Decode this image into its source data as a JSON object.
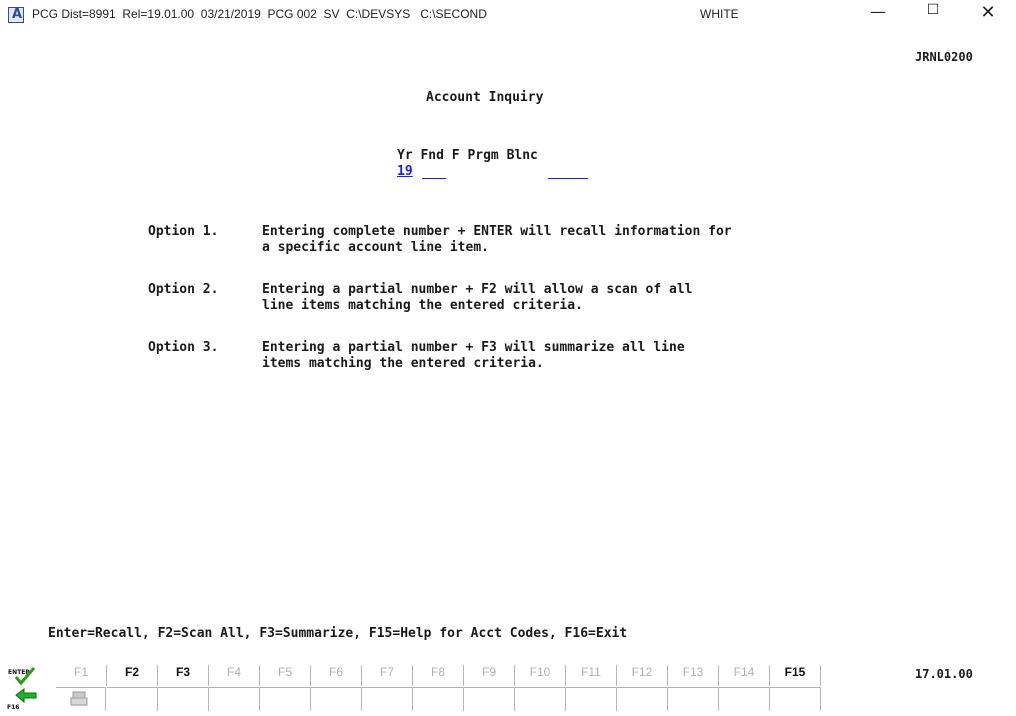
{
  "titlebar": {
    "icon_letter": "A",
    "text": "PCG Dist=8991  Rel=19.01.00  03/21/2019  PCG 002  SV  C:\\DEVSYS   C:\\SECOND",
    "user": "WHITE",
    "minimize": "—",
    "maximize": "☐",
    "close": "✕"
  },
  "screen_id": "JRNL0200",
  "page_title": "Account Inquiry",
  "account_header": "Yr Fnd F Prgm Blnc",
  "year_value": "19",
  "options": [
    {
      "label": "Option 1.",
      "line1": "Entering complete number + ENTER will recall information for",
      "line2": "a specific account line item."
    },
    {
      "label": "Option 2.",
      "line1": "Entering a partial number + F2 will allow a scan of all",
      "line2": "line items matching the entered criteria."
    },
    {
      "label": "Option 3.",
      "line1": "Entering a partial number + F3 will summarize all line",
      "line2": "items matching the entered criteria."
    }
  ],
  "help_line": "Enter=Recall, F2=Scan All, F3=Summarize, F15=Help for Acct Codes, F16=Exit",
  "version": "17.01.00",
  "fkeys": [
    {
      "label": "F1",
      "enabled": false
    },
    {
      "label": "F2",
      "enabled": true
    },
    {
      "label": "F3",
      "enabled": true
    },
    {
      "label": "F4",
      "enabled": false
    },
    {
      "label": "F5",
      "enabled": false
    },
    {
      "label": "F6",
      "enabled": false
    },
    {
      "label": "F7",
      "enabled": false
    },
    {
      "label": "F8",
      "enabled": false
    },
    {
      "label": "F9",
      "enabled": false
    },
    {
      "label": "F10",
      "enabled": false
    },
    {
      "label": "F11",
      "enabled": false
    },
    {
      "label": "F12",
      "enabled": false
    },
    {
      "label": "F13",
      "enabled": false
    },
    {
      "label": "F14",
      "enabled": false
    },
    {
      "label": "F15",
      "enabled": true
    }
  ],
  "enter_key": "ENTER",
  "exit_key": "F16",
  "colors": {
    "field_blue": "#1a1aff",
    "enter_green": "#2e9a1a",
    "exit_green": "#1fb32a"
  }
}
